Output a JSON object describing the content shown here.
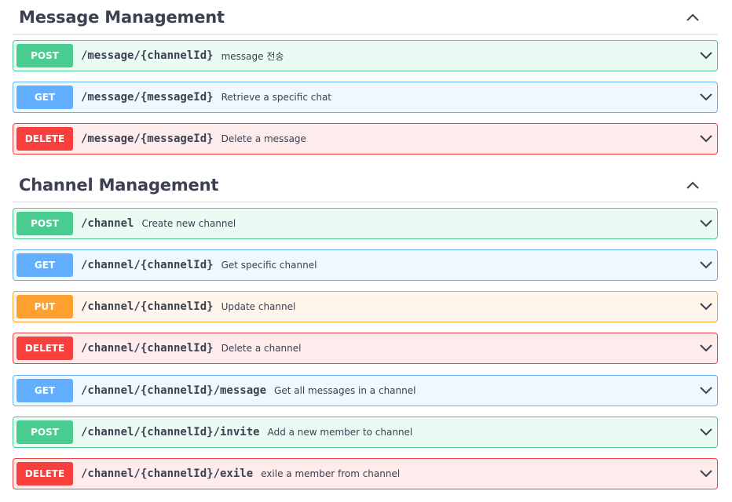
{
  "sections": [
    {
      "title": "Message Management",
      "operations": [
        {
          "method": "POST",
          "path": "/message/{channelId}",
          "summary": "message 전송"
        },
        {
          "method": "GET",
          "path": "/message/{messageId}",
          "summary": "Retrieve a specific chat"
        },
        {
          "method": "DELETE",
          "path": "/message/{messageId}",
          "summary": "Delete a message"
        }
      ]
    },
    {
      "title": "Channel Management",
      "operations": [
        {
          "method": "POST",
          "path": "/channel",
          "summary": "Create new channel"
        },
        {
          "method": "GET",
          "path": "/channel/{channelId}",
          "summary": "Get specific channel"
        },
        {
          "method": "PUT",
          "path": "/channel/{channelId}",
          "summary": "Update channel"
        },
        {
          "method": "DELETE",
          "path": "/channel/{channelId}",
          "summary": "Delete a channel"
        },
        {
          "method": "GET",
          "path": "/channel/{channelId}/message",
          "summary": "Get all messages in a channel"
        },
        {
          "method": "POST",
          "path": "/channel/{channelId}/invite",
          "summary": "Add a new member to channel"
        },
        {
          "method": "DELETE",
          "path": "/channel/{channelId}/exile",
          "summary": "exile a member from channel"
        }
      ]
    }
  ],
  "colors": {
    "post": "#49cc90",
    "get": "#61affe",
    "delete": "#f93e3e",
    "put": "#fca130",
    "text": "#3b4151"
  },
  "icons": {
    "section_toggle": "chevron-up-icon",
    "operation_toggle": "chevron-down-icon"
  }
}
